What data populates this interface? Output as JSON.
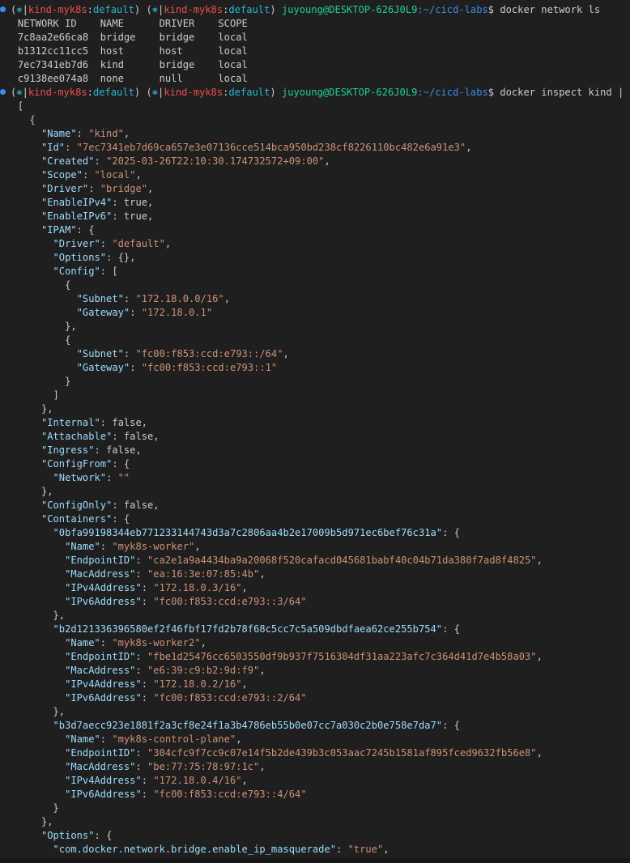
{
  "prompt": {
    "open": "(",
    "k8s_icon": "⎈",
    "sep": "|",
    "cluster": "kind-myk8s",
    "colon": ":",
    "namespace": "default",
    "close": ")",
    "user_host": "juyoung@DESKTOP-626J0L9",
    "path": ":~/cicd-labs",
    "dollar": "$"
  },
  "commands": [
    "docker network ls",
    "docker inspect kind | jq"
  ],
  "network_ls": {
    "headers": [
      "NETWORK ID",
      "NAME",
      "DRIVER",
      "SCOPE"
    ],
    "rows": [
      [
        "7c8aa2e66ca8",
        "bridge",
        "bridge",
        "local"
      ],
      [
        "b1312cc11cc5",
        "host",
        "host",
        "local"
      ],
      [
        "7ec7341eb7d6",
        "kind",
        "bridge",
        "local"
      ],
      [
        "c9138ee074a8",
        "none",
        "null",
        "local"
      ]
    ]
  },
  "json_lines": [
    [
      0,
      "[",
      "",
      "",
      ""
    ],
    [
      2,
      "{",
      "",
      "",
      ""
    ],
    [
      4,
      "",
      "Name",
      "s",
      "kind"
    ],
    [
      4,
      "",
      "Id",
      "s",
      "7ec7341eb7d69ca657e3e07136cce514bca950bd238cf8226110bc482e6a91e3"
    ],
    [
      4,
      "",
      "Created",
      "s",
      "2025-03-26T22:10:30.174732572+09:00"
    ],
    [
      4,
      "",
      "Scope",
      "s",
      "local"
    ],
    [
      4,
      "",
      "Driver",
      "s",
      "bridge"
    ],
    [
      4,
      "",
      "EnableIPv4",
      "p",
      "true,"
    ],
    [
      4,
      "",
      "EnableIPv6",
      "p",
      "true,"
    ],
    [
      4,
      "",
      "IPAM",
      "p",
      "{"
    ],
    [
      6,
      "",
      "Driver",
      "s",
      "default"
    ],
    [
      6,
      "",
      "Options",
      "p",
      "{},"
    ],
    [
      6,
      "",
      "Config",
      "p",
      "["
    ],
    [
      8,
      "{",
      "",
      "",
      ""
    ],
    [
      10,
      "",
      "Subnet",
      "s",
      "172.18.0.0/16"
    ],
    [
      10,
      "",
      "Gateway",
      "s2",
      "172.18.0.1"
    ],
    [
      8,
      "},",
      "",
      "",
      ""
    ],
    [
      8,
      "{",
      "",
      "",
      ""
    ],
    [
      10,
      "",
      "Subnet",
      "s",
      "fc00:f853:ccd:e793::/64"
    ],
    [
      10,
      "",
      "Gateway",
      "s2",
      "fc00:f853:ccd:e793::1"
    ],
    [
      8,
      "}",
      "",
      "",
      ""
    ],
    [
      6,
      "]",
      "",
      "",
      ""
    ],
    [
      4,
      "},",
      "",
      "",
      ""
    ],
    [
      4,
      "",
      "Internal",
      "p",
      "false,"
    ],
    [
      4,
      "",
      "Attachable",
      "p",
      "false,"
    ],
    [
      4,
      "",
      "Ingress",
      "p",
      "false,"
    ],
    [
      4,
      "",
      "ConfigFrom",
      "p",
      "{"
    ],
    [
      6,
      "",
      "Network",
      "s2",
      ""
    ],
    [
      4,
      "},",
      "",
      "",
      ""
    ],
    [
      4,
      "",
      "ConfigOnly",
      "p",
      "false,"
    ],
    [
      4,
      "",
      "Containers",
      "p",
      "{"
    ],
    [
      6,
      "",
      "0bfa99198344eb771233144743d3a7c2806aa4b2e17009b5d971ec6bef76c31a",
      "p",
      "{"
    ],
    [
      8,
      "",
      "Name",
      "s",
      "myk8s-worker"
    ],
    [
      8,
      "",
      "EndpointID",
      "s",
      "ca2e1a9a4434ba9a20068f520cafacd045681babf40c04b71da380f7ad8f4825"
    ],
    [
      8,
      "",
      "MacAddress",
      "s",
      "ea:16:3e:07:85:4b"
    ],
    [
      8,
      "",
      "IPv4Address",
      "s",
      "172.18.0.3/16"
    ],
    [
      8,
      "",
      "IPv6Address",
      "s2",
      "fc00:f853:ccd:e793::3/64"
    ],
    [
      6,
      "},",
      "",
      "",
      ""
    ],
    [
      6,
      "",
      "b2d121336396580ef2f46fbf17fd2b78f68c5cc7c5a509dbdfaea62ce255b754",
      "p",
      "{"
    ],
    [
      8,
      "",
      "Name",
      "s",
      "myk8s-worker2"
    ],
    [
      8,
      "",
      "EndpointID",
      "s",
      "fbe1d25476cc6503550df9b937f7516304df31aa223afc7c364d41d7e4b58a03"
    ],
    [
      8,
      "",
      "MacAddress",
      "s",
      "e6:39:c9:b2:9d:f9"
    ],
    [
      8,
      "",
      "IPv4Address",
      "s",
      "172.18.0.2/16"
    ],
    [
      8,
      "",
      "IPv6Address",
      "s2",
      "fc00:f853:ccd:e793::2/64"
    ],
    [
      6,
      "},",
      "",
      "",
      ""
    ],
    [
      6,
      "",
      "b3d7aecc923e1881f2a3cf8e24f1a3b4786eb55b0e07cc7a030c2b0e758e7da7",
      "p",
      "{"
    ],
    [
      8,
      "",
      "Name",
      "s",
      "myk8s-control-plane"
    ],
    [
      8,
      "",
      "EndpointID",
      "s",
      "304cfc9f7cc9c07e14f5b2de439b3c053aac7245b1581af895fced9632fb56e8"
    ],
    [
      8,
      "",
      "MacAddress",
      "s",
      "be:77:75:78:97:1c"
    ],
    [
      8,
      "",
      "IPv4Address",
      "s",
      "172.18.0.4/16"
    ],
    [
      8,
      "",
      "IPv6Address",
      "s2",
      "fc00:f853:ccd:e793::4/64"
    ],
    [
      6,
      "}",
      "",
      "",
      ""
    ],
    [
      4,
      "},",
      "",
      "",
      ""
    ],
    [
      4,
      "",
      "Options",
      "p",
      "{"
    ],
    [
      6,
      "",
      "com.docker.network.bridge.enable_ip_masquerade",
      "s",
      "true"
    ]
  ],
  "colors": {
    "background": "#1f1f1f",
    "json_key": "#9cdcfe",
    "json_string": "#ce9178",
    "k8s_cluster": "#f14c4c",
    "user_host": "#23d18b",
    "path": "#3b8eea"
  },
  "icons": [
    "prompt-status-dot-icon",
    "kubernetes-helm-icon"
  ]
}
